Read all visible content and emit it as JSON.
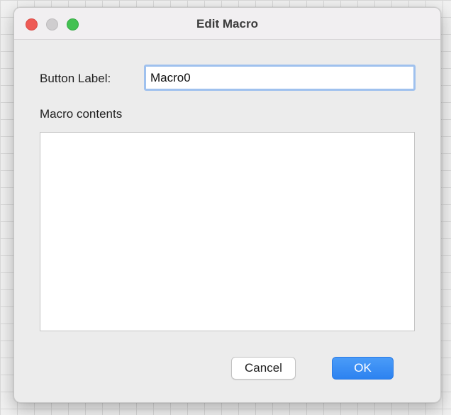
{
  "window": {
    "title": "Edit Macro"
  },
  "form": {
    "button_label_label": "Button Label:",
    "button_label_value": "Macro0",
    "macro_contents_label": "Macro contents",
    "macro_contents_value": ""
  },
  "buttons": {
    "cancel_label": "Cancel",
    "ok_label": "OK"
  },
  "colors": {
    "close": "#ee5a55",
    "minimize": "#cfcdcf",
    "zoom": "#43c152",
    "accent": "#2c82f0",
    "focus_ring": "#9fc1ee"
  }
}
